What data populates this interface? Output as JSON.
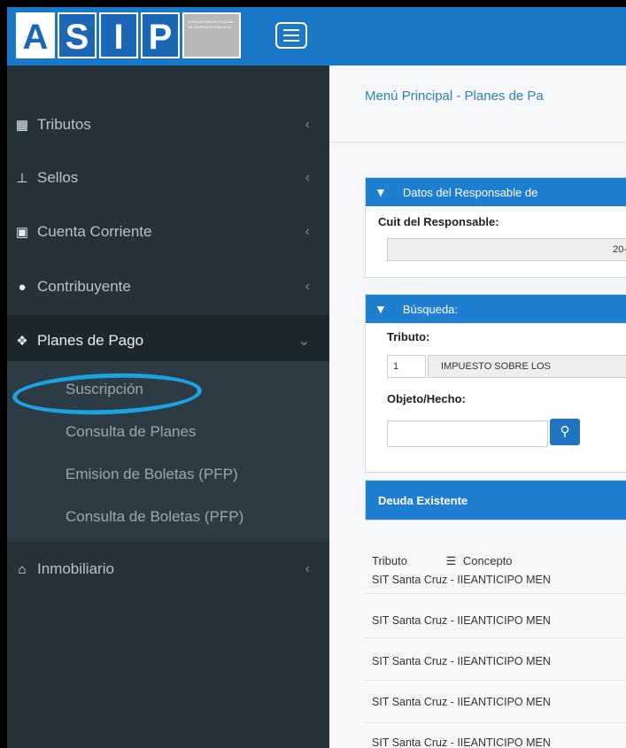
{
  "header": {
    "logo_letters": [
      "A",
      "S",
      "I",
      "P"
    ],
    "logo_subtext": "AGENCIA SANTACRUCEÑA DE INGRESOS PÚBLICOS",
    "accent_color": "#1a78c8",
    "menu_icon": "hamburger-icon"
  },
  "sidebar": {
    "items": [
      {
        "label": "Tributos",
        "icon": "grid-icon",
        "arrow": "‹"
      },
      {
        "label": "Sellos",
        "icon": "stamp-icon",
        "arrow": "‹"
      },
      {
        "label": "Cuenta Corriente",
        "icon": "ledger-icon",
        "arrow": "‹"
      },
      {
        "label": "Contribuyente",
        "icon": "user-icon",
        "arrow": "‹"
      },
      {
        "label": "Planes de Pago",
        "icon": "handshake-icon",
        "arrow": "⌄"
      },
      {
        "label": "Inmobiliario",
        "icon": "home-icon",
        "arrow": "‹"
      }
    ],
    "submenu": [
      "Suscripción",
      "Consulta de Planes",
      "Emision de Boletas (PFP)",
      "Consulta de Boletas (PFP)"
    ],
    "highlight_color": "#1aa3e0"
  },
  "main": {
    "breadcrumb": "Menú Principal - Planes de Pa",
    "responsable_panel": {
      "title": "Datos del Responsable de",
      "cuit_label": "Cuit del Responsable:",
      "cuit_value": "20-"
    },
    "busqueda_panel": {
      "title": "Búsqueda:",
      "tributo_label": "Tributo:",
      "tributo_code": "1",
      "tributo_name": "IMPUESTO SOBRE LOS",
      "objeto_label": "Objeto/Hecho:",
      "objeto_value": ""
    },
    "deuda_panel": {
      "title": "Deuda Existente",
      "columns": [
        "Tributo",
        "Concepto"
      ],
      "rows": [
        "SIT Santa Cruz - IIEANTICIPO MEN",
        "SIT Santa Cruz - IIEANTICIPO MEN",
        "SIT Santa Cruz - IIEANTICIPO MEN",
        "SIT Santa Cruz - IIEANTICIPO MEN",
        "SIT Santa Cruz - IIEANTICIPO MEN"
      ]
    }
  }
}
